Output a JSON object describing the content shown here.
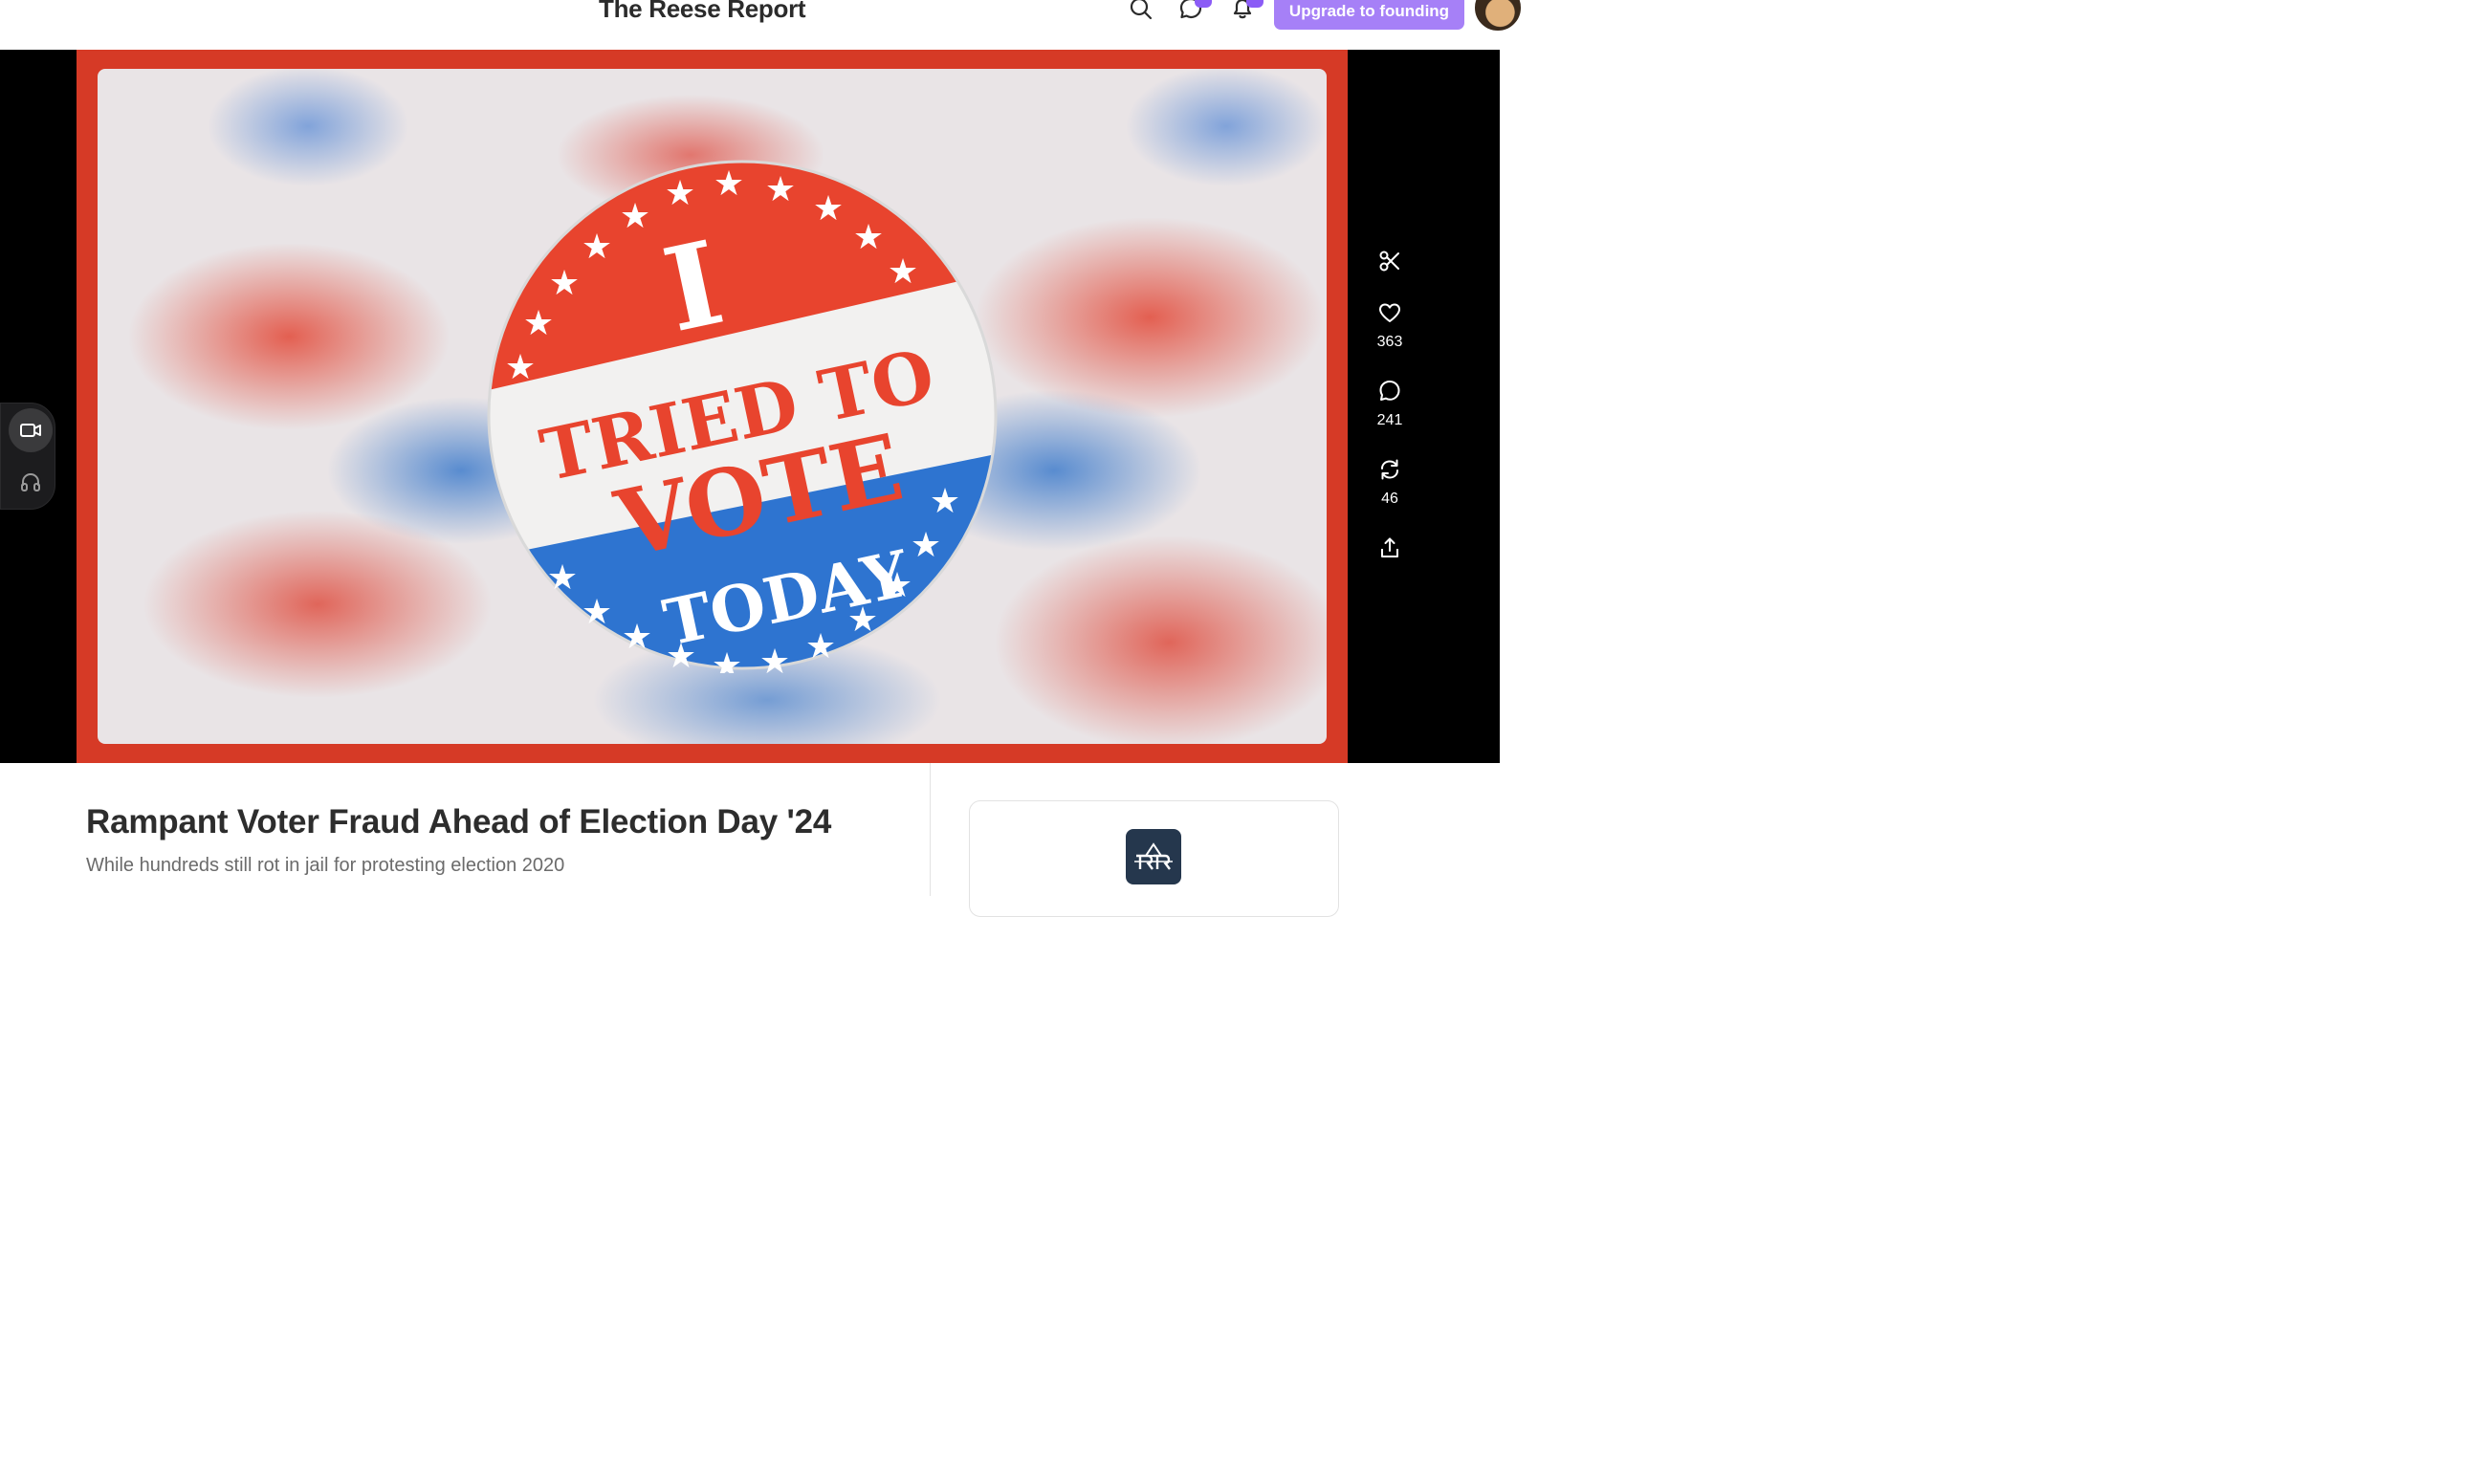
{
  "header": {
    "publication_title": "The Reese Report",
    "upgrade_label": "Upgrade to founding",
    "accent_color": "#a680f7"
  },
  "hero": {
    "image_description_icon": "i-tried-to-vote-today-sticker",
    "sticker": {
      "line1": "I",
      "line2": "TRIED TO",
      "line3": "VOTE",
      "line4": "TODAY"
    }
  },
  "media_toggle": {
    "items": [
      {
        "icon": "video-camera-icon",
        "active": true
      },
      {
        "icon": "headphones-icon",
        "active": false
      }
    ]
  },
  "actions": {
    "likes": "363",
    "comments": "241",
    "restacks": "46"
  },
  "post": {
    "title": "Rampant Voter Fraud Ahead of Election Day '24",
    "subtitle": "While hundreds still rot in jail for protesting election 2020"
  },
  "colors": {
    "sticker_red": "#e8442e",
    "sticker_blue": "#2e74d0",
    "frame_red": "#d63a26"
  }
}
